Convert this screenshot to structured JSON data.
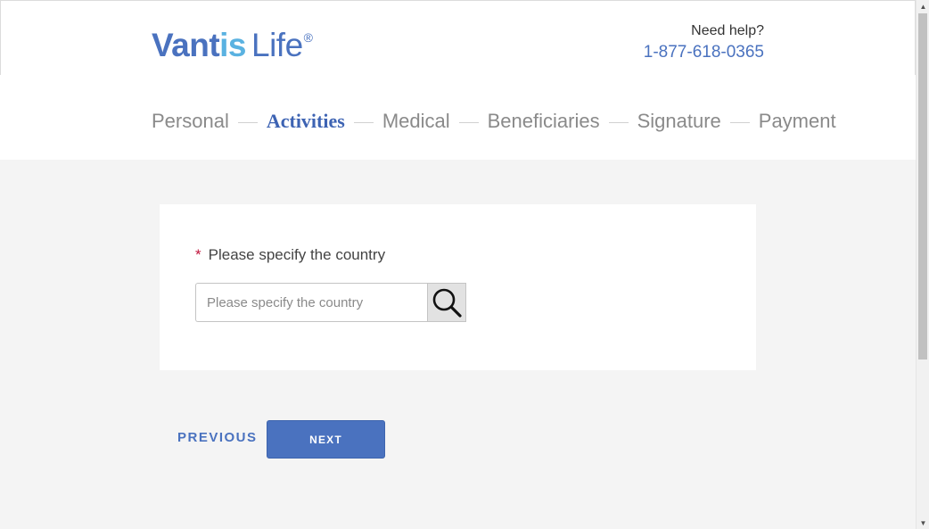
{
  "header": {
    "logo": {
      "part1": "Vantis",
      "part2": "is",
      "part3": "Life",
      "mark": "®"
    },
    "help_label": "Need help?",
    "help_phone": "1-877-618-0365"
  },
  "steps": [
    {
      "label": "Personal",
      "active": false
    },
    {
      "label": "Activities",
      "active": true
    },
    {
      "label": "Medical",
      "active": false
    },
    {
      "label": "Beneficiaries",
      "active": false
    },
    {
      "label": "Signature",
      "active": false
    },
    {
      "label": "Payment",
      "active": false
    }
  ],
  "form": {
    "required_marker": "*",
    "country_label": "Please specify the country",
    "country_placeholder": "Please specify the country",
    "country_value": "",
    "search_icon": "search-icon"
  },
  "nav": {
    "previous_label": "PREVIOUS",
    "next_label": "NEXT"
  },
  "colors": {
    "brand_blue": "#4a72bf",
    "brand_light_blue": "#5ab2e1",
    "active_step": "#3d63b3",
    "required": "#c0143c",
    "background": "#f4f4f4"
  },
  "scrollbar": {
    "up_icon": "scroll-up-arrow-icon",
    "down_icon": "scroll-down-arrow-icon"
  }
}
